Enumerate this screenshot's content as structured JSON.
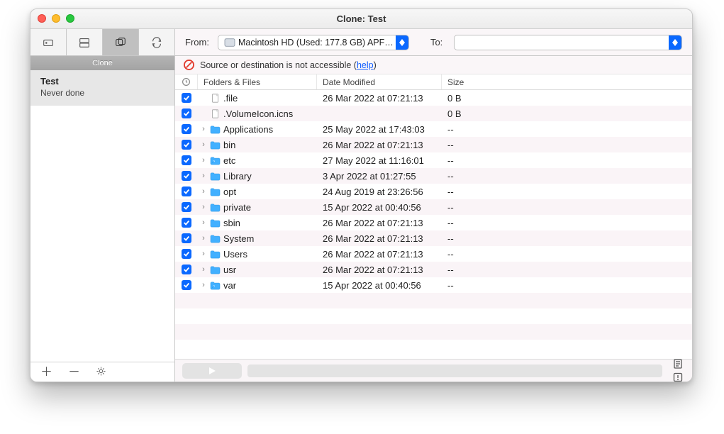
{
  "window": {
    "title": "Clone: Test"
  },
  "toolbar": {
    "from_label": "From:",
    "from_value": "Macintosh HD (Used: 177.8 GB)  APFS...",
    "to_label": "To:",
    "to_value": ""
  },
  "sidebar": {
    "header": "Clone",
    "items": [
      {
        "title": "Test",
        "subtitle": "Never done"
      }
    ]
  },
  "warning": {
    "text": "Source or destination is not accessible (",
    "help": "help",
    "close": ")"
  },
  "table": {
    "headers": {
      "status": "",
      "name": "Folders & Files",
      "date": "Date Modified",
      "size": "Size"
    },
    "rows": [
      {
        "checked": true,
        "expandable": false,
        "icon": "file",
        "name": ".file",
        "date": "26 Mar 2022 at 07:21:13",
        "size": "0 B"
      },
      {
        "checked": true,
        "expandable": false,
        "icon": "file",
        "name": ".VolumeIcon.icns",
        "date": "",
        "size": "0 B"
      },
      {
        "checked": true,
        "expandable": true,
        "icon": "folder",
        "name": "Applications",
        "date": "25 May 2022 at 17:43:03",
        "size": "--"
      },
      {
        "checked": true,
        "expandable": true,
        "icon": "folder",
        "name": "bin",
        "date": "26 Mar 2022 at 07:21:13",
        "size": "--"
      },
      {
        "checked": true,
        "expandable": true,
        "icon": "link",
        "name": "etc",
        "date": "27 May 2022 at 11:16:01",
        "size": "--"
      },
      {
        "checked": true,
        "expandable": true,
        "icon": "folder",
        "name": "Library",
        "date": "3 Apr 2022 at 01:27:55",
        "size": "--"
      },
      {
        "checked": true,
        "expandable": true,
        "icon": "folder",
        "name": "opt",
        "date": "24 Aug 2019 at 23:26:56",
        "size": "--"
      },
      {
        "checked": true,
        "expandable": true,
        "icon": "folder",
        "name": "private",
        "date": "15 Apr 2022 at 00:40:56",
        "size": "--"
      },
      {
        "checked": true,
        "expandable": true,
        "icon": "folder",
        "name": "sbin",
        "date": "26 Mar 2022 at 07:21:13",
        "size": "--"
      },
      {
        "checked": true,
        "expandable": true,
        "icon": "folder",
        "name": "System",
        "date": "26 Mar 2022 at 07:21:13",
        "size": "--"
      },
      {
        "checked": true,
        "expandable": true,
        "icon": "folder",
        "name": "Users",
        "date": "26 Mar 2022 at 07:21:13",
        "size": "--"
      },
      {
        "checked": true,
        "expandable": true,
        "icon": "folder",
        "name": "usr",
        "date": "26 Mar 2022 at 07:21:13",
        "size": "--"
      },
      {
        "checked": true,
        "expandable": true,
        "icon": "link",
        "name": "var",
        "date": "15 Apr 2022 at 00:40:56",
        "size": "--"
      }
    ]
  }
}
